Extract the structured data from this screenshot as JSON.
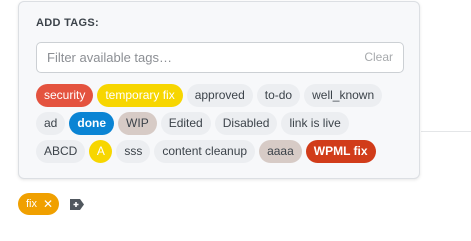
{
  "popup": {
    "title": "ADD TAGS:",
    "filter_placeholder": "Filter available tags…",
    "filter_value": "",
    "clear_label": "Clear"
  },
  "tag_rows": [
    [
      {
        "label": "security",
        "bg": "#e4533f",
        "fg": "#ffffff",
        "bold": false
      },
      {
        "label": "temporary fix",
        "bg": "#f7d600",
        "fg": "#ffffff",
        "bold": false
      },
      {
        "label": "approved",
        "bg": "#eceef1",
        "fg": "#3c434a",
        "bold": false
      },
      {
        "label": "to-do",
        "bg": "#eceef1",
        "fg": "#3c434a",
        "bold": false
      },
      {
        "label": "well_known",
        "bg": "#eceef1",
        "fg": "#3c434a",
        "bold": false
      }
    ],
    [
      {
        "label": "ad",
        "bg": "#eceef1",
        "fg": "#3c434a",
        "bold": false
      },
      {
        "label": "done",
        "bg": "#0a84d4",
        "fg": "#ffffff",
        "bold": true
      },
      {
        "label": "WIP",
        "bg": "#d7cbc6",
        "fg": "#3c434a",
        "bold": false
      },
      {
        "label": "Edited",
        "bg": "#eceef1",
        "fg": "#3c434a",
        "bold": false
      },
      {
        "label": "Disabled",
        "bg": "#eceef1",
        "fg": "#3c434a",
        "bold": false
      },
      {
        "label": "link is live",
        "bg": "#eceef1",
        "fg": "#3c434a",
        "bold": false
      }
    ],
    [
      {
        "label": "ABCD",
        "bg": "#eceef1",
        "fg": "#3c434a",
        "bold": false
      },
      {
        "label": "A",
        "bg": "#f7d600",
        "fg": "#ffffff",
        "bold": false,
        "round": true
      },
      {
        "label": "sss",
        "bg": "#eceef1",
        "fg": "#3c434a",
        "bold": false
      },
      {
        "label": "content cleanup",
        "bg": "#eceef1",
        "fg": "#3c434a",
        "bold": false
      },
      {
        "label": "aaaa",
        "bg": "#d7cbc6",
        "fg": "#3c434a",
        "bold": false
      },
      {
        "label": "WPML fix",
        "bg": "#d13c1a",
        "fg": "#ffffff",
        "bold": true
      }
    ]
  ],
  "selected_tags": [
    {
      "label": "fix",
      "bg": "#f0a000",
      "fg": "#ffffff"
    }
  ],
  "icons": {
    "remove": "close-icon",
    "add_tag": "add-tag-icon"
  },
  "colors": {
    "panel_bg": "#f7f8fa",
    "panel_border": "#dcdfe3",
    "add_tag_icon": "#50575e"
  }
}
